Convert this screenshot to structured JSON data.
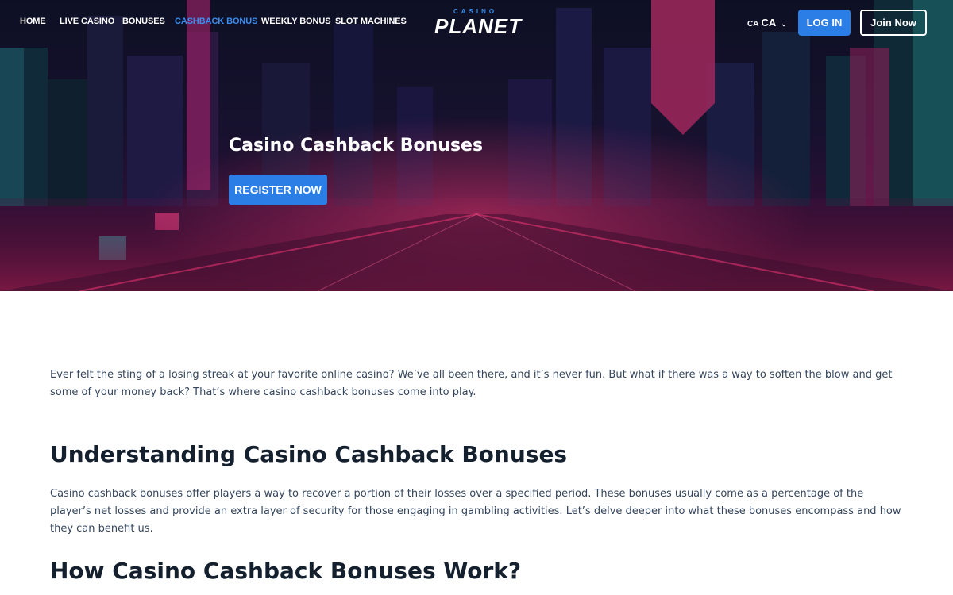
{
  "nav": {
    "items": [
      {
        "label": "HOME",
        "active": false
      },
      {
        "label": "LIVE CASINO",
        "active": false
      },
      {
        "label": "BONUSES",
        "active": false
      },
      {
        "label": "CASHBACK BONUS",
        "active": true
      },
      {
        "label": "WEEKLY BONUS",
        "active": false
      },
      {
        "label": "SLOT MACHINES",
        "active": false
      }
    ],
    "logo": {
      "top_text": "CASINO",
      "main_text": "PLANET"
    },
    "language": {
      "flag": "CA",
      "code": "CA",
      "chevron_icon": "chevron-down-icon"
    },
    "login_label": "LOG IN",
    "join_label": "Join Now"
  },
  "hero": {
    "title": "Casino Cashback Bonuses",
    "register_label": "REGISTER NOW"
  },
  "article": {
    "intro": "Ever felt the sting of a losing streak at your favorite online casino? We’ve all been there, and it’s never fun. But what if there was a way to soften the blow and get some of your money back? That’s where casino cashback bonuses come into play.",
    "section1_heading": "Understanding Casino Cashback Bonuses",
    "section1_text": "Casino cashback bonuses offer players a way to recover a portion of their losses over a specified period. These bonuses usually come as a percentage of the player’s net losses and provide an extra layer of security for those engaging in gambling activities. Let’s delve deeper into what these bonuses encompass and how they can benefit us.",
    "section2_heading": "How Casino Cashback Bonuses Work?"
  },
  "colors": {
    "accent": "#2b7ee6",
    "active_nav": "#3a8ff0",
    "text": "#34455c",
    "heading": "#15202e"
  }
}
